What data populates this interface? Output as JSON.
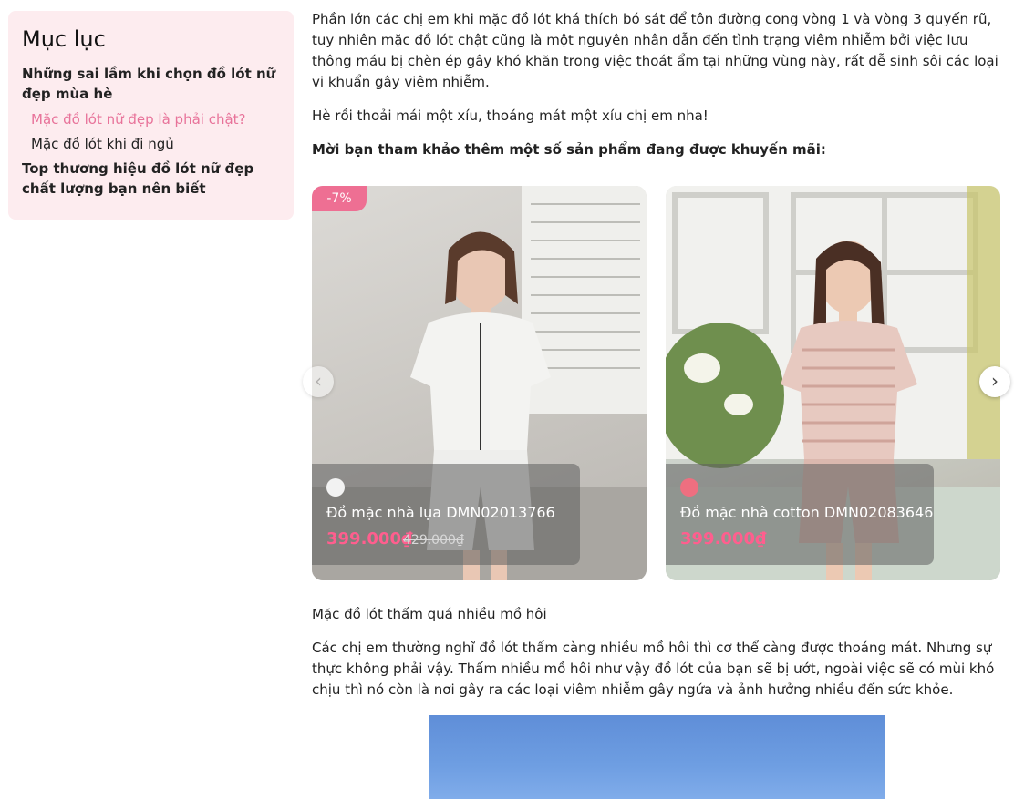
{
  "toc": {
    "title": "Mục lục",
    "items": [
      {
        "label": "Những sai lầm khi chọn đồ lót nữ đẹp mùa hè"
      },
      {
        "label": "Mặc đồ lót nữ đẹp là phải chật?"
      },
      {
        "label": "Mặc đồ lót khi đi ngủ"
      },
      {
        "label": "Top thương hiệu đồ lót nữ đẹp chất lượng bạn nên biết"
      }
    ]
  },
  "article": {
    "p1": "Phần lớn các chị em khi mặc đồ lót khá thích bó sát để tôn đường cong vòng 1 và vòng 3 quyến rũ, tuy nhiên mặc đồ lót chật cũng là một nguyên nhân dẫn đến tình trạng viêm nhiễm bởi việc lưu thông máu bị chèn ép gây khó khăn trong việc thoát ẩm tại những vùng này, rất dễ sinh sôi các loại vi khuẩn gây viêm nhiễm.",
    "p2": "Hè rồi thoải mái một xíu, thoáng mát một xíu chị em nha!",
    "p3": "Mời bạn tham khảo thêm một số sản phẩm đang được khuyến mãi:",
    "p4": "Mặc đồ lót thấm quá nhiều mồ hôi",
    "p5": "Các chị em thường nghĩ đồ lót thấm càng nhiều mồ hôi thì cơ thể càng được thoáng mát. Nhưng sự thực không phải vậy. Thấm nhiều mồ hôi như vậy đồ lót của bạn sẽ bị ướt, ngoài việc sẽ có mùi khó chịu thì nó còn là nơi gây ra các loại viêm nhiễm gây ngứa và ảnh hưởng nhiều đến sức khỏe."
  },
  "products": [
    {
      "badge": "-7%",
      "swatch_color": "#f2f2f2",
      "name": "Đồ mặc nhà lụa DMN02013766",
      "price": "399.000₫",
      "old_price": "429.000₫"
    },
    {
      "swatch_color": "#ee6f80",
      "name": "Đồ mặc nhà cotton DMN02083646",
      "price": "399.000₫"
    }
  ],
  "carousel": {
    "prev_icon": "chevron-left-icon",
    "next_icon": "chevron-right-icon",
    "prev_glyph": "‹",
    "next_glyph": "›"
  },
  "colors": {
    "accent_pink": "#ee6f93",
    "toc_background": "#fdecef",
    "price_pink": "#ff5e8e"
  }
}
